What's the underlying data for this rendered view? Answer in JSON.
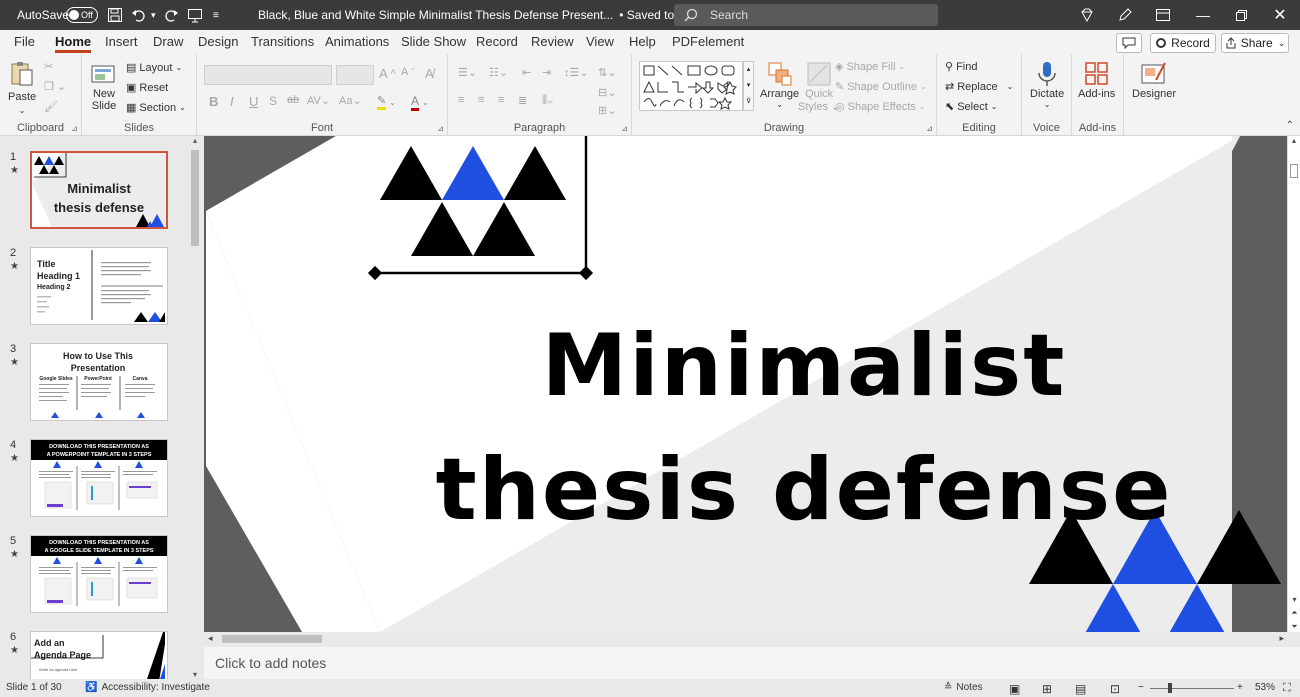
{
  "titlebar": {
    "autosave_label": "AutoSave",
    "autosave_state": "Off",
    "doc_title": "Black, Blue and White Simple Minimalist Thesis Defense Present...",
    "save_status": "• Saved to this PC",
    "search_placeholder": "Search"
  },
  "menu": {
    "tabs": [
      "File",
      "Home",
      "Insert",
      "Draw",
      "Design",
      "Transitions",
      "Animations",
      "Slide Show",
      "Record",
      "Review",
      "View",
      "Help",
      "PDFelement"
    ],
    "active_tab": "Home",
    "record_label": "Record",
    "share_label": "Share"
  },
  "ribbon": {
    "clipboard": {
      "label": "Clipboard",
      "paste": "Paste"
    },
    "slides": {
      "label": "Slides",
      "new_slide": "New",
      "new_slide2": "Slide",
      "layout": "Layout",
      "reset": "Reset",
      "section": "Section"
    },
    "font": {
      "label": "Font"
    },
    "paragraph": {
      "label": "Paragraph"
    },
    "drawing": {
      "label": "Drawing",
      "arrange": "Arrange",
      "quick_styles": "Quick",
      "quick_styles2": "Styles",
      "shape_fill": "Shape Fill",
      "shape_outline": "Shape Outline",
      "shape_effects": "Shape Effects"
    },
    "editing": {
      "label": "Editing",
      "find": "Find",
      "replace": "Replace",
      "select": "Select"
    },
    "voice": {
      "label": "Voice",
      "dictate": "Dictate"
    },
    "addins": {
      "label": "Add-ins",
      "addins_btn": "Add-ins"
    },
    "designer": {
      "label": "Designer"
    }
  },
  "slides": [
    {
      "num": "1",
      "star": "★",
      "title_a": "Minimalist",
      "title_b": "thesis defense"
    },
    {
      "num": "2",
      "star": "★",
      "t1": "Title",
      "t2": "Heading 1",
      "t3": "Heading 2"
    },
    {
      "num": "3",
      "star": "★",
      "title_a": "How to Use This",
      "title_b": "Presentation",
      "c1": "Google Slides",
      "c2": "PowerPoint",
      "c3": "Canva"
    },
    {
      "num": "4",
      "star": "★",
      "title_a": "DOWNLOAD THIS PRESENTATION AS",
      "title_b": "A POWERPOINT TEMPLATE IN 3 STEPS"
    },
    {
      "num": "5",
      "star": "★",
      "title_a": "DOWNLOAD THIS PRESENTATION AS",
      "title_b": "A GOOGLE SLIDE TEMPLATE IN 3 STEPS"
    },
    {
      "num": "6",
      "star": "★",
      "title_a": "Add an",
      "title_b": "Agenda Page",
      "sub": "Write an agenda here"
    }
  ],
  "main_slide": {
    "title_line1": "Minimalist",
    "title_line2": "thesis defense"
  },
  "notes_placeholder": "Click to add notes",
  "status": {
    "slide_info": "Slide 1 of 30",
    "accessibility": "Accessibility: Investigate",
    "notes": "Notes",
    "zoom": "53%"
  },
  "colors": {
    "blue": "#1f4fe0",
    "black": "#000000",
    "accent": "#c43e1c"
  }
}
